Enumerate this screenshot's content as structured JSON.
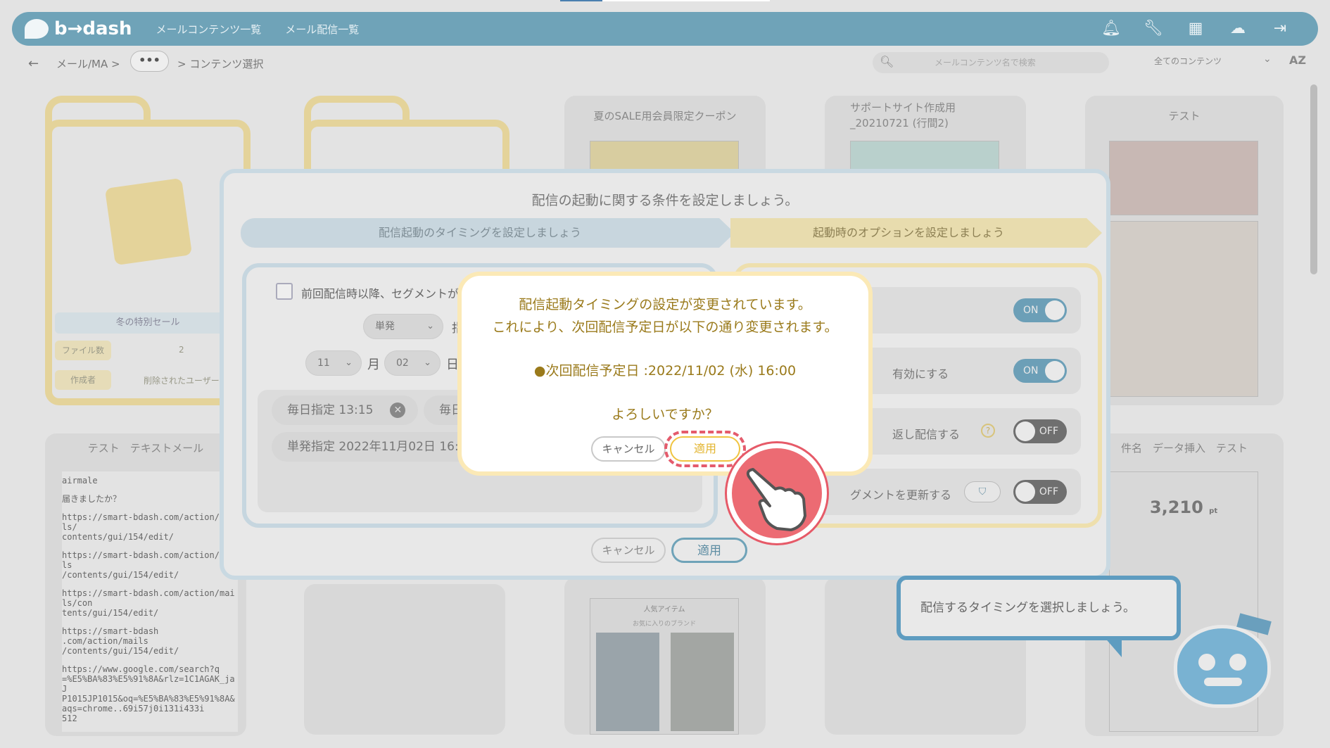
{
  "header": {
    "logo": "b→dash",
    "nav": [
      "メールコンテンツ一覧",
      "メール配信一覧"
    ],
    "icons": [
      "bell-icon",
      "wrench-icon",
      "grid-icon",
      "cloud-icon",
      "logout-icon"
    ]
  },
  "breadcrumb": {
    "back": "←",
    "mail": "メール/MA >",
    "more": "•••",
    "current": "> コンテンツ選択"
  },
  "search": {
    "placeholder": "メールコンテンツ名で検索"
  },
  "filter": {
    "selected": "全てのコンテンツ",
    "sort": "AZ"
  },
  "cards": {
    "folder1": {
      "name": "冬の特別セール",
      "files_label": "ファイル数",
      "files": "2",
      "author_label": "作成者",
      "author": "削除されたユーザー"
    },
    "card3_title": "夏のSALE用会員限定クーポン",
    "card4_title": "サポートサイト作成用_20210721 (行間2)",
    "card5_title": "テスト",
    "row2_card1_title": "テスト　テキストメール",
    "row2_card5_title": "件名　データ挿入　テスト",
    "text_lines": [
      "airmale",
      "届きましたか？",
      "https://smart-bdash.com/action/mails/\ncontents/gui/154/edit/",
      "https://smart-bdash.com/action/mails\n/contents/gui/154/edit/",
      "https://smart-bdash.com/action/mails/con\ntents/gui/154/edit/",
      "https://smart-bdash\n.com/action/mails\n/contents/gui/154/edit/",
      "https://www.google.com/search?q\n=%E5%BA%83%E5%91%8A&rlz=1C1AGAK_jaJ\nP1015JP1015&oq=%E5%BA%83%E5%91%8A&aqs=chrome..69i57j0i131i433i\n512"
    ],
    "points": "3,210",
    "points_unit": "pt",
    "popular": "人気アイテム",
    "brand": "お気に入りのブランド"
  },
  "modal": {
    "title": "配信の起動に関する条件を設定しましょう。",
    "step1": "配信起動のタイミングを設定しましょう",
    "step2": "起動時のオプションを設定しましょう",
    "checkbox_label": "前回配信時以降、セグメントが",
    "type_select": "単発",
    "type_suffix": "指",
    "month_value": "11",
    "month_label": "月",
    "day_value": "02",
    "day_label": "日",
    "tags": [
      "毎日指定 13:15",
      "毎日",
      "単発指定 2022年11月02日 16:"
    ],
    "options": [
      {
        "label": "",
        "state": "ON"
      },
      {
        "label": "有効にする",
        "state": "ON"
      },
      {
        "label": "返し配信する",
        "state": "OFF"
      },
      {
        "label": "グメントを更新する",
        "state": "OFF"
      }
    ],
    "cancel": "キャンセル",
    "apply": "適用"
  },
  "confirm": {
    "line1": "配信起動タイミングの設定が変更されています。",
    "line2": "これにより、次回配信予定日が以下の通り変更されます。",
    "next": "●次回配信予定日 :2022/11/02 (水) 16:00",
    "question": "よろしいですか？",
    "cancel": "キャンセル",
    "apply": "適用"
  },
  "tooltip": {
    "text": "配信するタイミングを選択しましょう。"
  },
  "colors": {
    "accent_blue": "#6fa3b8",
    "gold": "#9a7a1b",
    "highlight": "#e45b6c",
    "apply_border": "#f0c441"
  }
}
